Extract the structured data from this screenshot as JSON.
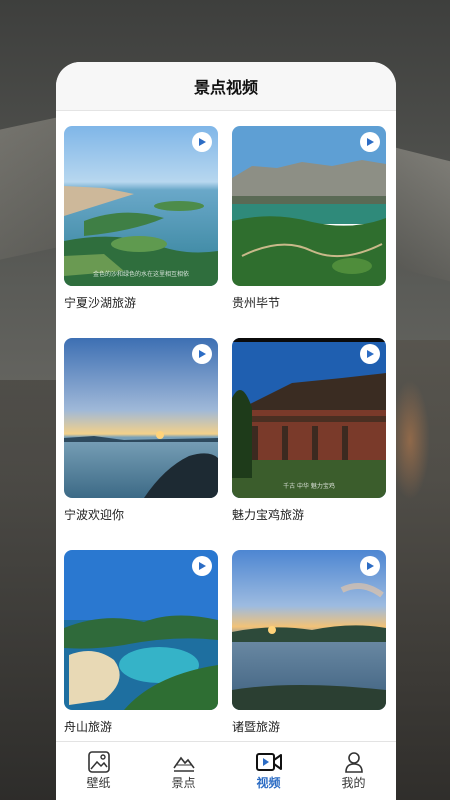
{
  "header": {
    "title": "景点视频"
  },
  "videos": [
    {
      "caption": "宁夏沙湖旅游",
      "overlay": "金色的沙和绿色的水在这里相互相依",
      "icon": "play-icon"
    },
    {
      "caption": "贵州毕节",
      "overlay": "",
      "icon": "play-icon"
    },
    {
      "caption": "宁波欢迎你",
      "overlay": "",
      "icon": "play-icon"
    },
    {
      "caption": "魅力宝鸡旅游",
      "overlay": "千古 中华 魅力宝鸡",
      "icon": "play-icon"
    },
    {
      "caption": "舟山旅游",
      "overlay": "",
      "icon": "play-icon"
    },
    {
      "caption": "诸暨旅游",
      "overlay": "",
      "icon": "play-icon"
    }
  ],
  "tabbar": {
    "items": [
      {
        "label": "壁纸",
        "icon": "image-icon",
        "active": false
      },
      {
        "label": "景点",
        "icon": "mountain-icon",
        "active": false
      },
      {
        "label": "视频",
        "icon": "video-camera-icon",
        "active": true
      },
      {
        "label": "我的",
        "icon": "person-icon",
        "active": false
      }
    ]
  },
  "colors": {
    "accent": "#2c6cc4",
    "play_icon": "#2c6cc4"
  }
}
